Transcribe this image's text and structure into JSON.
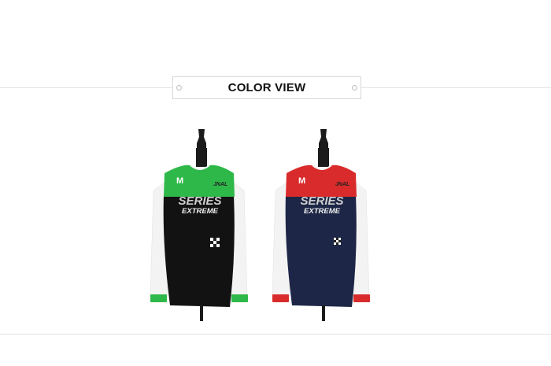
{
  "section": {
    "title": "COLOR VIEW"
  },
  "products": [
    {
      "label_letter": "M",
      "chest_text_1": "SERIES",
      "chest_text_2": "EXTREME",
      "logo_text": "JNAL",
      "colors": {
        "accent": "#2fb84a",
        "body": "#121212",
        "sleeve": "#f4f4f4"
      }
    },
    {
      "label_letter": "M",
      "chest_text_1": "SERIES",
      "chest_text_2": "EXTREME",
      "logo_text": "JNAL",
      "colors": {
        "accent": "#d92b2b",
        "body": "#1d2646",
        "sleeve": "#f4f4f4"
      }
    }
  ]
}
